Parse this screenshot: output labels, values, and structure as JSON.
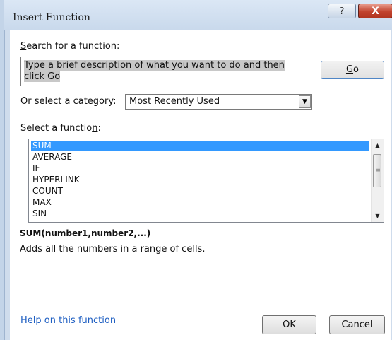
{
  "window": {
    "title": "Insert Function",
    "help_button": "?",
    "close_button": "X"
  },
  "search": {
    "label_prefix": "",
    "label_mnemonic": "S",
    "label_rest": "earch for a function:",
    "value": "Type a brief description of what you want to do and then click Go",
    "go_mnemonic": "G",
    "go_rest": "o"
  },
  "category": {
    "label_a": "Or select a ",
    "label_mnemonic": "c",
    "label_b": "ategory:",
    "selected": "Most Recently Used"
  },
  "functions": {
    "label_a": "Select a functio",
    "label_mnemonic": "n",
    "label_b": ":",
    "items": [
      "SUM",
      "AVERAGE",
      "IF",
      "HYPERLINK",
      "COUNT",
      "MAX",
      "SIN"
    ],
    "selected_index": 0
  },
  "details": {
    "signature": "SUM(number1,number2,...)",
    "description": "Adds all the numbers in a range of cells."
  },
  "footer": {
    "help_link": "Help on this function",
    "ok_label": "OK",
    "cancel_label": "Cancel"
  }
}
